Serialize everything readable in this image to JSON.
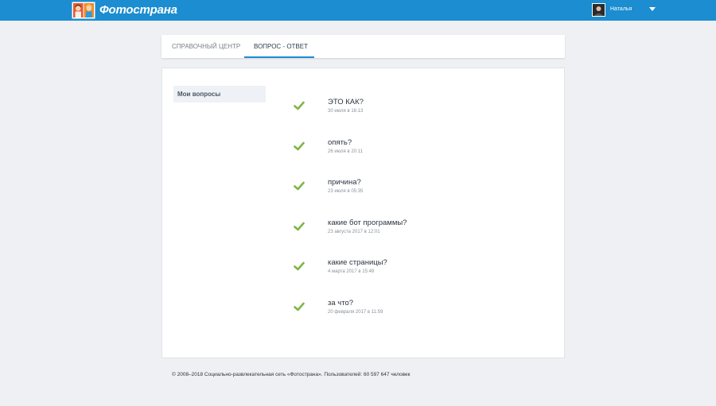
{
  "header": {
    "logo_text": "Фотострана",
    "username": "Наталья",
    "colors": {
      "brand": "#1b8dd0"
    }
  },
  "tabs": [
    {
      "label": "СПРАВОЧНЫЙ ЦЕНТР",
      "active": false
    },
    {
      "label": "ВОПРОС - ОТВЕТ",
      "active": true
    }
  ],
  "sidebar": {
    "items": [
      {
        "label": "Мои вопросы",
        "icon": "none"
      }
    ]
  },
  "questions": [
    {
      "title": "ЭТО КАК?",
      "date": "30 июля в 16:13",
      "status_icon": "check-icon"
    },
    {
      "title": "опять?",
      "date": "26 июля в 20:11",
      "status_icon": "check-icon"
    },
    {
      "title": "причина?",
      "date": "23 июля в 05:35",
      "status_icon": "check-icon"
    },
    {
      "title": "какие бот программы?",
      "date": "23 августа 2017 в 12:01",
      "status_icon": "check-icon"
    },
    {
      "title": "какие страницы?",
      "date": "4 марта 2017 в 15:49",
      "status_icon": "check-icon"
    },
    {
      "title": "за что?",
      "date": "20 февраля 2017 в 11:59",
      "status_icon": "check-icon"
    }
  ],
  "footer": {
    "text": "© 2008–2018 Социально-развлекательная сеть «Фотострана». Пользователей: 60 597 647 человек"
  }
}
